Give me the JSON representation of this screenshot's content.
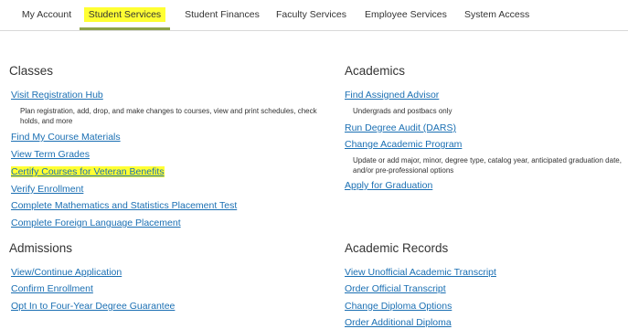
{
  "tabs": [
    {
      "label": "My Account"
    },
    {
      "label": "Student Services"
    },
    {
      "label": "Student Finances"
    },
    {
      "label": "Faculty Services"
    },
    {
      "label": "Employee Services"
    },
    {
      "label": "System Access"
    }
  ],
  "colors": {
    "link": "#1a6fb3",
    "highlight": "#ffff33",
    "active_tab_underline": "#8fa34a"
  },
  "classes": {
    "title": "Classes",
    "visit_registration_hub": "Visit Registration Hub",
    "visit_registration_hub_desc": "Plan registration, add, drop, and make changes to courses, view and print schedules, check holds, and more",
    "find_course_materials": "Find My Course Materials",
    "view_term_grades": "View Term Grades",
    "certify_veteran": "Certify Courses for Veteran Benefits",
    "verify_enrollment": "Verify Enrollment",
    "math_placement": "Complete Mathematics and Statistics Placement Test",
    "language_placement": "Complete Foreign Language Placement"
  },
  "academics": {
    "title": "Academics",
    "find_advisor": "Find Assigned Advisor",
    "find_advisor_desc": "Undergrads and postbacs only",
    "degree_audit": "Run Degree Audit (DARS)",
    "change_program": "Change Academic Program",
    "change_program_desc": "Update or add major, minor, degree type, catalog year, anticipated graduation date, and/or pre-professional options",
    "apply_graduation": "Apply for Graduation"
  },
  "admissions": {
    "title": "Admissions",
    "view_application": "View/Continue Application",
    "confirm_enrollment": "Confirm Enrollment",
    "opt_in_guarantee": "Opt In to Four-Year Degree Guarantee"
  },
  "records": {
    "title": "Academic Records",
    "unofficial_transcript": "View Unofficial Academic Transcript",
    "official_transcript": "Order Official Transcript",
    "diploma_options": "Change Diploma Options",
    "additional_diploma": "Order Additional Diploma"
  }
}
